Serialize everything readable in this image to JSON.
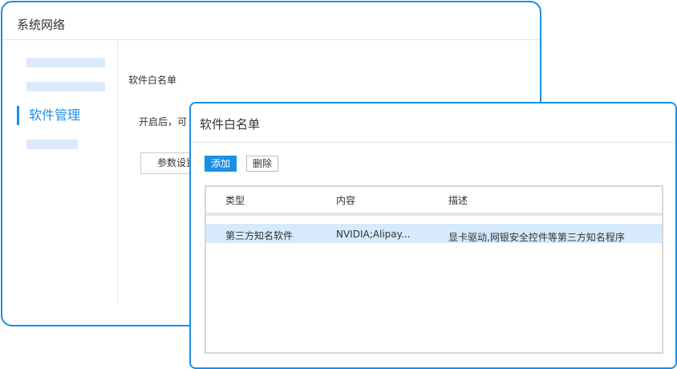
{
  "back_window": {
    "title": "系统网络",
    "sidebar": {
      "active_item": "软件管理"
    },
    "main": {
      "section_heading": "软件白名单",
      "description": "开启后，可",
      "param_button": "参数设置"
    }
  },
  "dialog": {
    "title": "软件白名单",
    "toolbar": {
      "add_label": "添加",
      "delete_label": "删除"
    },
    "table": {
      "columns": [
        "类型",
        "内容",
        "描述"
      ],
      "rows": [
        {
          "type": "第三方知名软件",
          "content": "NVIDIA;Alipay...",
          "description": "显卡驱动,网银安全控件等第三方知名程序",
          "selected": true
        }
      ]
    }
  },
  "colors": {
    "accent": "#1a8fe6",
    "selected_row": "#d6eafc",
    "placeholder": "#dbeafb"
  }
}
